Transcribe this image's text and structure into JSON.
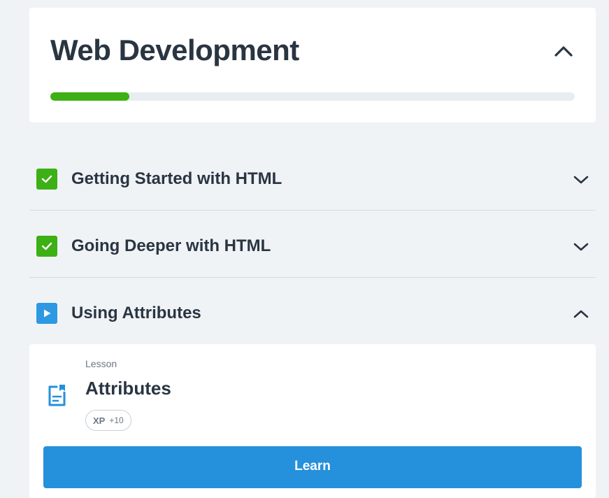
{
  "course": {
    "title": "Web Development",
    "progress_fraction": 0.15,
    "progress_color": "#3cb015",
    "collapse_icon": "chevron-up-icon"
  },
  "modules": [
    {
      "title": "Getting Started with HTML",
      "status": "completed",
      "status_icon": "check-icon",
      "status_color": "#3cb015",
      "chevron_icon": "chevron-down-icon"
    },
    {
      "title": "Going Deeper with HTML",
      "status": "completed",
      "status_icon": "check-icon",
      "status_color": "#3cb015",
      "chevron_icon": "chevron-down-icon"
    },
    {
      "title": "Using Attributes",
      "status": "in-progress",
      "status_icon": "play-icon",
      "status_color": "#2e98e3",
      "chevron_icon": "chevron-up-icon"
    }
  ],
  "lesson": {
    "type": "Lesson",
    "title": "Attributes",
    "icon": "document-icon",
    "xp_label": "XP",
    "xp_value": "+10",
    "button_label": "Learn",
    "button_color": "#2590db"
  }
}
